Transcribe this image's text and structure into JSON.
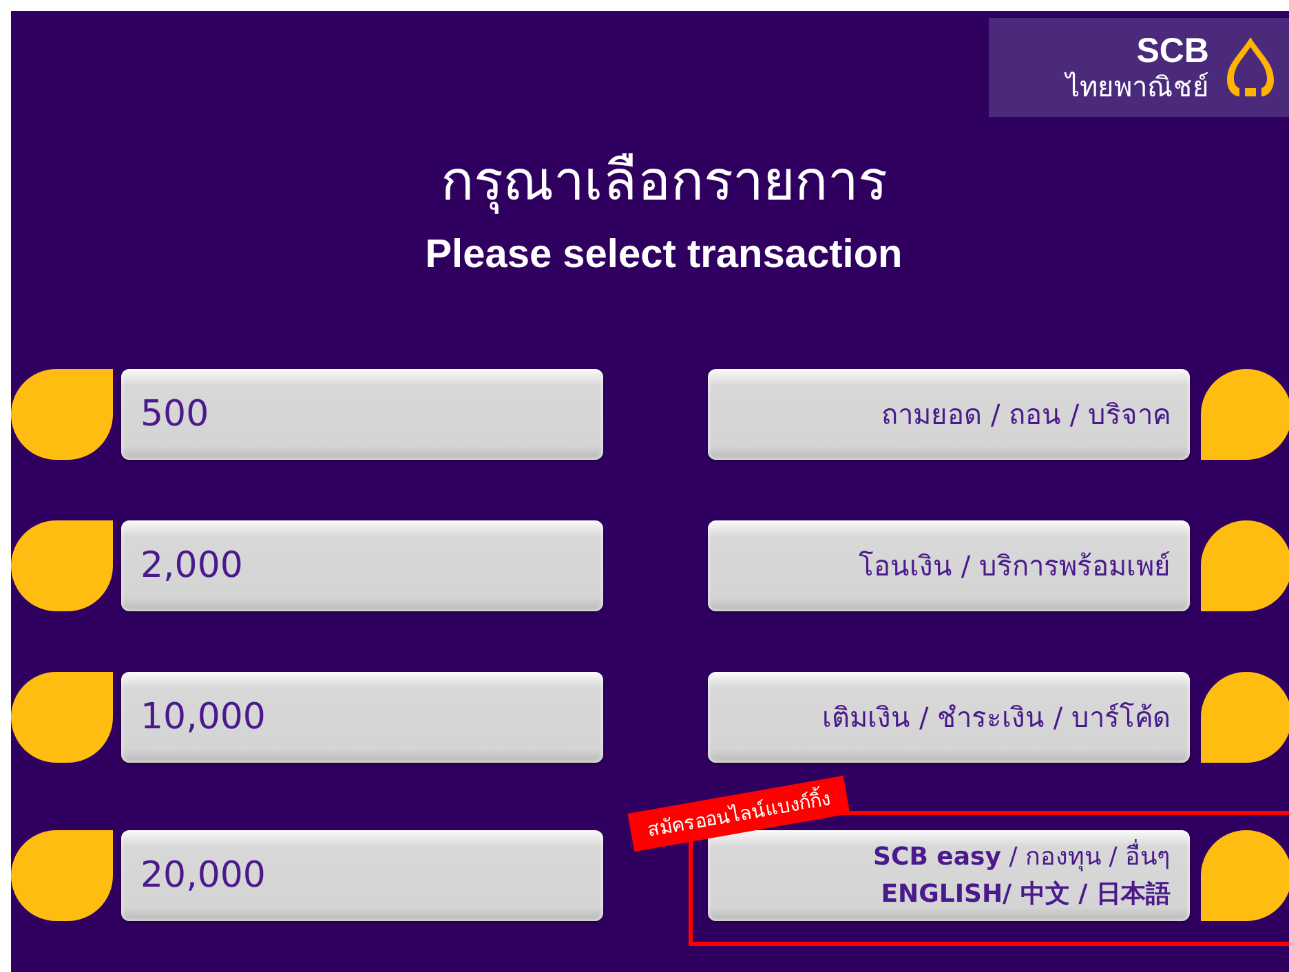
{
  "logo": {
    "brand": "SCB",
    "name": "ไทยพาณิชย์"
  },
  "title": "กรุณาเลือกรายการ",
  "subtitle": "Please select transaction",
  "left_options": [
    {
      "label": "500"
    },
    {
      "label": "2,000"
    },
    {
      "label": "10,000"
    },
    {
      "label": "20,000"
    }
  ],
  "right_options": [
    {
      "lines": [
        "ถามยอด / ถอน / บริจาค"
      ],
      "highlighted": false
    },
    {
      "lines": [
        "โอนเงิน / บริการพร้อมเพย์"
      ],
      "highlighted": false
    },
    {
      "lines": [
        "เติมเงิน / ชำระเงิน / บาร์โค้ด"
      ],
      "highlighted": false
    },
    {
      "lines": [
        "**SCB easy** / กองทุน / อื่นๆ",
        "**ENGLISH/  中文 / 日本語**"
      ],
      "ribbon": "สมัครออนไลน์แบงก์กิ้ง",
      "highlighted": true
    }
  ]
}
